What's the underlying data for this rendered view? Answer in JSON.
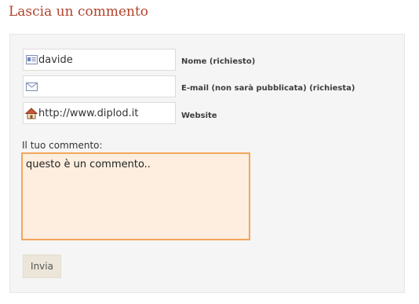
{
  "title": "Lascia un commento",
  "form": {
    "name": {
      "value": "davide",
      "label": "Nome (richiesto)",
      "icon": "contact-card-icon"
    },
    "email": {
      "value": "",
      "label": "E-mail (non sarà pubblicata) (richiesta)",
      "icon": "envelope-icon"
    },
    "website": {
      "value": "http://www.diplod.it",
      "label": "Website",
      "icon": "home-icon"
    },
    "comment": {
      "label": "Il tuo commento:",
      "value": "questo è un commento.."
    },
    "submit_label": "Invia"
  },
  "colors": {
    "title": "#b0432a",
    "comment_border": "#f2a65c",
    "comment_background": "#fdeedf",
    "panel_background": "#f5f5f5",
    "button_background": "#ebe6d9"
  }
}
